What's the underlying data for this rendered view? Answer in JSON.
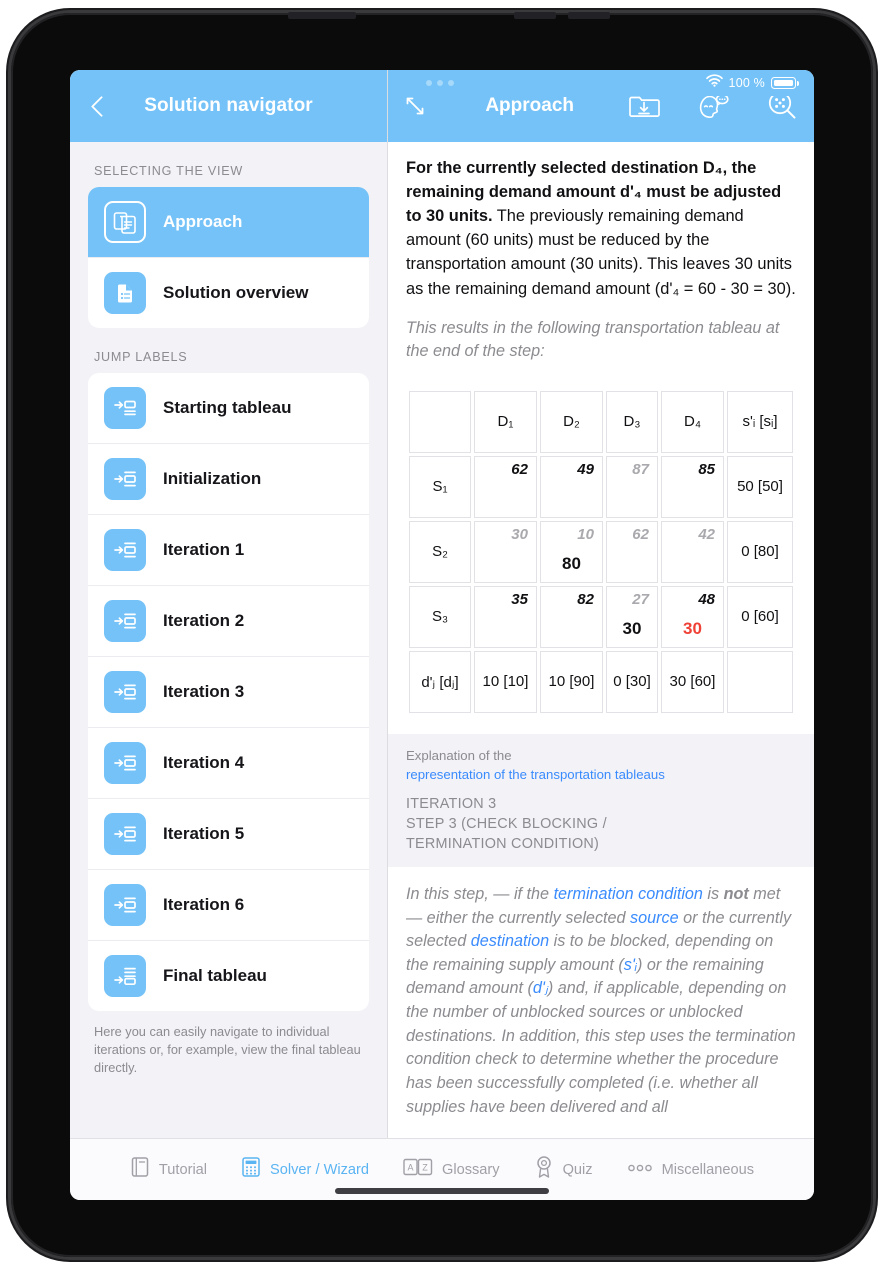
{
  "status_bar": {
    "battery_percent": "100 %",
    "wifi_icon": "wifi-icon"
  },
  "left_pane": {
    "navbar": {
      "back_icon": "back-chevron-icon",
      "title": "Solution navigator"
    },
    "sections": [
      {
        "label": "SELECTING THE VIEW",
        "items": [
          {
            "label": "Approach",
            "icon": "documents-stack-icon",
            "selected": true
          },
          {
            "label": "Solution overview",
            "icon": "document-list-icon",
            "selected": false
          }
        ]
      },
      {
        "label": "JUMP LABELS",
        "items": [
          {
            "label": "Starting tableau",
            "icon": "jump-to-icon"
          },
          {
            "label": "Initialization",
            "icon": "jump-to-icon"
          },
          {
            "label": "Iteration 1",
            "icon": "jump-to-icon"
          },
          {
            "label": "Iteration 2",
            "icon": "jump-to-icon"
          },
          {
            "label": "Iteration 3",
            "icon": "jump-to-icon"
          },
          {
            "label": "Iteration 4",
            "icon": "jump-to-icon"
          },
          {
            "label": "Iteration 5",
            "icon": "jump-to-icon"
          },
          {
            "label": "Iteration 6",
            "icon": "jump-to-icon"
          },
          {
            "label": "Final tableau",
            "icon": "jump-to-icon-last"
          }
        ]
      }
    ],
    "footnote": "Here you can easily navigate to individual iterations or, for example, view the final tableau directly."
  },
  "right_pane": {
    "navbar": {
      "expand_icon": "expand-arrows-icon",
      "title": "Approach",
      "icons": [
        "folder-download-icon",
        "avatar-chat-icon",
        "search-grid-icon"
      ]
    },
    "paragraph": {
      "bold_part": "For the currently selected destination D₄, the remaining demand amount d'₄ must be adjusted to 30 units.",
      "rest": " The previously remaining demand amount (60 units) must be reduced by the transportation amount (30 units). This leaves 30 units as the remaining demand amount (d'₄ = 60 - 30 = 30)."
    },
    "tableau_intro": "This results in the following transportation tableau at the end of the step:",
    "explanation": {
      "line1": "Explanation of the",
      "link": "representation of the transportation tableaus",
      "step_head_line1": "ITERATION 3",
      "step_head_line2": "STEP 3 (CHECK BLOCKING /",
      "step_head_line3": "TERMINATION CONDITION)"
    },
    "step_description": {
      "t1": "In this step, — if the ",
      "l1": "termination condition",
      "t2": " is ",
      "b1": "not",
      "t3": " met — either the currently selected ",
      "l2": "source",
      "t4": " or the currently selected ",
      "l3": "destination",
      "t5": " is to be blocked, depending on the remaining supply amount (",
      "l4": "s'ᵢ",
      "t6": ") or the remaining demand amount (",
      "l5": "d'ⱼ",
      "t7": ") and, if applicable, depending on the number of unblocked sources or unblocked destinations. In addition, this step uses the termination condition check to determine whether the procedure has been successfully completed (i.e. whether all supplies have been delivered and all"
    }
  },
  "tableau": {
    "corner_label": "",
    "supply_header": "s'ᵢ [sᵢ]",
    "demand_row_label": "d'ⱼ [dⱼ]",
    "columns": [
      {
        "label": "D₁",
        "state": "normal"
      },
      {
        "label": "D₂",
        "state": "normal"
      },
      {
        "label": "D₃",
        "state": "blocked"
      },
      {
        "label": "D₄",
        "state": "selected"
      }
    ],
    "rows": [
      {
        "label": "S₁",
        "state": "normal",
        "cells": [
          {
            "cost": "62",
            "alloc": "",
            "state": "normal"
          },
          {
            "cost": "49",
            "alloc": "",
            "state": "normal"
          },
          {
            "cost": "87",
            "alloc": "",
            "state": "blocked"
          },
          {
            "cost": "85",
            "alloc": "",
            "state": "normal"
          }
        ],
        "supply": "50 [50]",
        "supply_state": "normal"
      },
      {
        "label": "S₂",
        "state": "blocked",
        "cells": [
          {
            "cost": "30",
            "alloc": "",
            "state": "blocked"
          },
          {
            "cost": "10",
            "alloc": "80",
            "state": "blocked"
          },
          {
            "cost": "62",
            "alloc": "",
            "state": "blocked"
          },
          {
            "cost": "42",
            "alloc": "",
            "state": "blocked"
          }
        ],
        "supply": "0 [80]",
        "supply_state": "blocked"
      },
      {
        "label": "S₃",
        "state": "selected",
        "cells": [
          {
            "cost": "35",
            "alloc": "",
            "state": "normal"
          },
          {
            "cost": "82",
            "alloc": "",
            "state": "normal"
          },
          {
            "cost": "27",
            "alloc": "30",
            "state": "blocked"
          },
          {
            "cost": "48",
            "alloc": "30",
            "state": "selected",
            "alloc_red": true
          }
        ],
        "supply": "0 [60]",
        "supply_state": "red"
      }
    ],
    "demands": [
      {
        "value": "10 [10]",
        "state": "normal"
      },
      {
        "value": "10 [90]",
        "state": "normal"
      },
      {
        "value": "0 [30]",
        "state": "blocked"
      },
      {
        "value": "30 [60]",
        "state": "red"
      }
    ]
  },
  "tabbar": {
    "tabs": [
      {
        "label": "Tutorial",
        "icon": "book-icon",
        "active": false
      },
      {
        "label": "Solver / Wizard",
        "icon": "calculator-icon",
        "active": true
      },
      {
        "label": "Glossary",
        "icon": "az-icon",
        "active": false
      },
      {
        "label": "Quiz",
        "icon": "medal-icon",
        "active": false
      },
      {
        "label": "Miscellaneous",
        "icon": "three-dots-icon",
        "active": false
      }
    ]
  },
  "colors": {
    "accent": "#74c2f7",
    "blocked_pink": "#f7dddc",
    "selected_blue": "#cbe6ea",
    "link_blue": "#3a8bfd",
    "red": "#ef4136",
    "muted_gray": "#8b8b90"
  }
}
